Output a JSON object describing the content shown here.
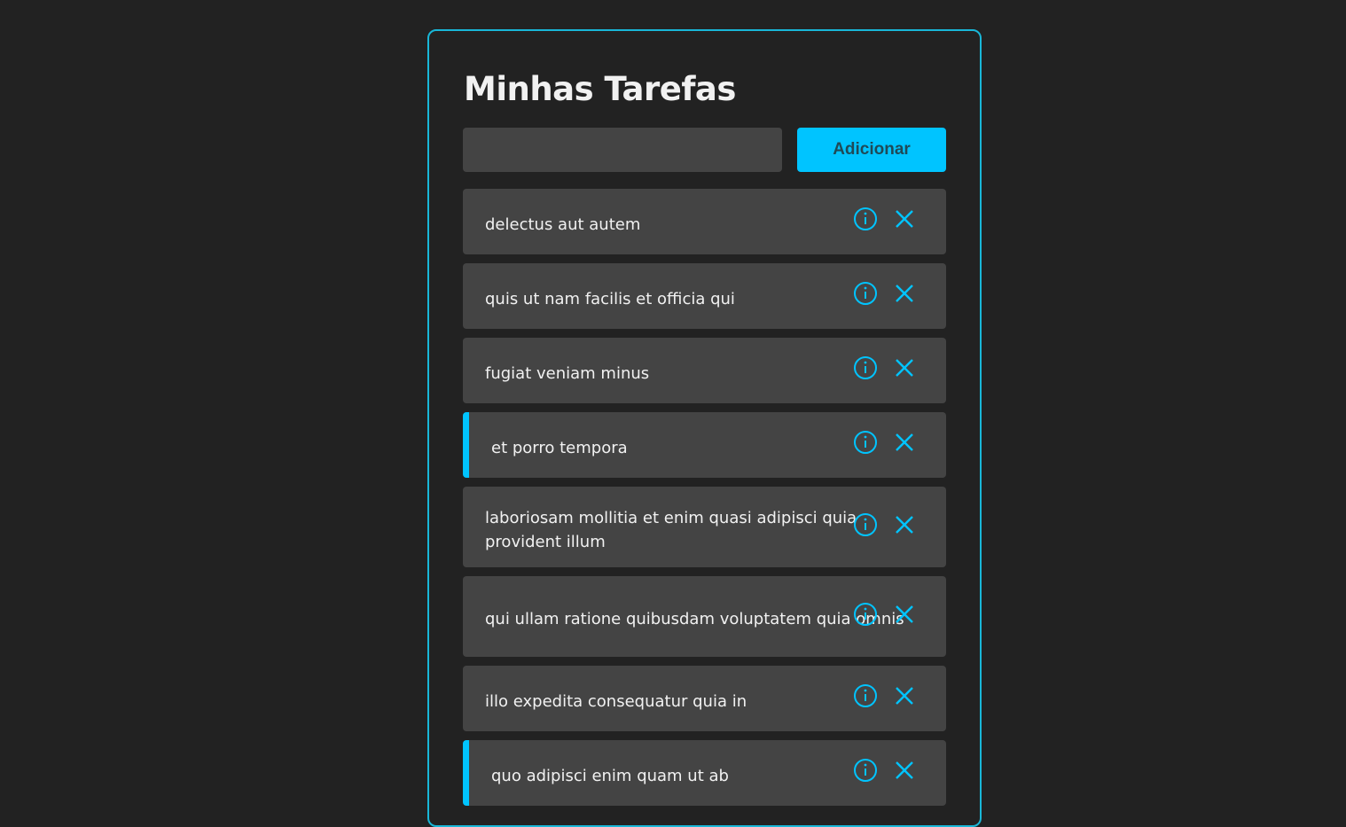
{
  "app": {
    "title": "Minhas Tarefas"
  },
  "form": {
    "input_value": "",
    "input_placeholder": "",
    "add_label": "Adicionar"
  },
  "colors": {
    "accent": "#00c4ff",
    "background": "#222222",
    "item_background": "#444444",
    "text": "#f1f1f1"
  },
  "icons": {
    "details": "info-circle-icon",
    "remove": "close-x-icon"
  },
  "tasks": [
    {
      "title": "delectus aut autem",
      "completed": false
    },
    {
      "title": "quis ut nam facilis et officia qui",
      "completed": false
    },
    {
      "title": "fugiat veniam minus",
      "completed": false
    },
    {
      "title": "et porro tempora",
      "completed": true
    },
    {
      "title": "laboriosam mollitia et enim quasi adipisci quia provident illum",
      "completed": false
    },
    {
      "title": "qui ullam ratione quibusdam voluptatem quia omnis",
      "completed": false
    },
    {
      "title": "illo expedita consequatur quia in",
      "completed": false
    },
    {
      "title": "quo adipisci enim quam ut ab",
      "completed": true
    }
  ]
}
